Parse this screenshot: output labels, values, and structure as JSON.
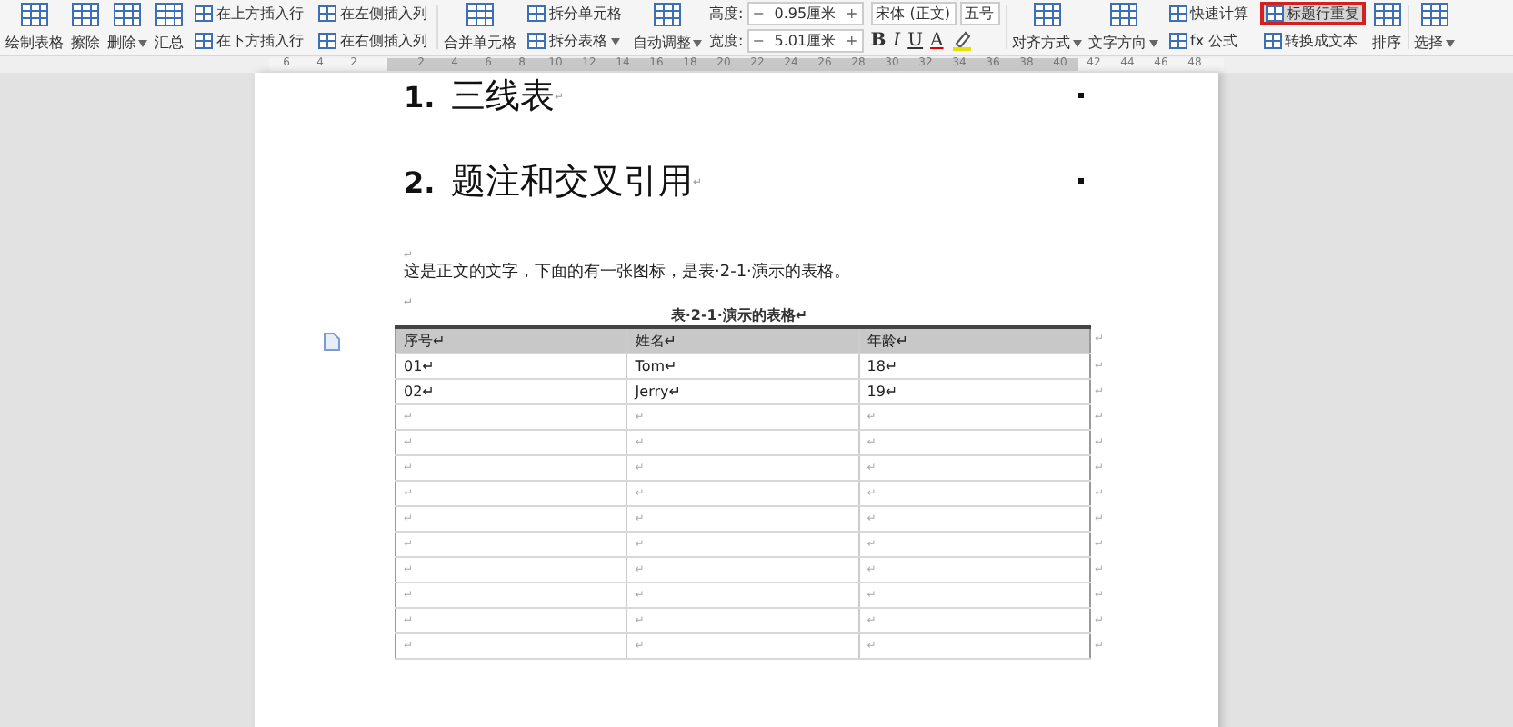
{
  "toolbar": {
    "items": [
      {
        "kind": "large",
        "label": "绘制表格",
        "dropdown": false
      },
      {
        "kind": "large",
        "label": "擦除",
        "dropdown": false
      },
      {
        "kind": "large",
        "label": "删除",
        "dropdown": true
      },
      {
        "kind": "large",
        "label": "汇总",
        "dropdown": false
      },
      {
        "kind": "stack",
        "rows": [
          {
            "label": "在上方插入行",
            "dropdown": false,
            "highlighted": false
          },
          {
            "label": "在下方插入行",
            "dropdown": false,
            "highlighted": false
          }
        ]
      },
      {
        "kind": "stack",
        "rows": [
          {
            "label": "在左侧插入列",
            "dropdown": false,
            "highlighted": false
          },
          {
            "label": "在右侧插入列",
            "dropdown": false,
            "highlighted": false
          }
        ]
      },
      {
        "kind": "large",
        "label": "合并单元格",
        "dropdown": false
      },
      {
        "kind": "stack",
        "rows": [
          {
            "label": "拆分单元格",
            "dropdown": false,
            "highlighted": false
          },
          {
            "label": "拆分表格",
            "dropdown": true,
            "highlighted": false
          }
        ]
      },
      {
        "kind": "large",
        "label": "自动调整",
        "dropdown": true
      },
      {
        "kind": "spin",
        "rows": [
          {
            "label": "高度:",
            "value": "0.95厘米",
            "minus": "−",
            "plus": "+"
          },
          {
            "label": "宽度:",
            "value": "5.01厘米",
            "minus": "−",
            "plus": "+"
          }
        ]
      },
      {
        "kind": "font",
        "font": "宋体 (正文)",
        "size": "五号",
        "buttons": [
          "B",
          "I",
          "U",
          "A"
        ]
      },
      {
        "kind": "large",
        "label": "对齐方式",
        "dropdown": true
      },
      {
        "kind": "large",
        "label": "文字方向",
        "dropdown": true
      },
      {
        "kind": "stack",
        "rows": [
          {
            "label": "快速计算",
            "dropdown": false,
            "highlighted": false
          },
          {
            "label": "fx 公式",
            "dropdown": false,
            "highlighted": false
          }
        ]
      },
      {
        "kind": "stack",
        "rows": [
          {
            "label": "标题行重复",
            "dropdown": false,
            "highlighted": true
          },
          {
            "label": "转换成文本",
            "dropdown": false,
            "highlighted": false
          }
        ]
      },
      {
        "kind": "large",
        "label": "排序",
        "dropdown": false
      },
      {
        "kind": "large",
        "label": "选择",
        "dropdown": true
      }
    ]
  },
  "ruler": {
    "labels": [
      "6",
      "4",
      "2",
      "2",
      "4",
      "6",
      "8",
      "10",
      "12",
      "14",
      "16",
      "18",
      "20",
      "22",
      "24",
      "26",
      "28",
      "30",
      "32",
      "34",
      "36",
      "38",
      "40",
      "42",
      "44",
      "46",
      "48"
    ]
  },
  "document": {
    "headings": [
      {
        "number": "1.",
        "text": "三线表",
        "mark": "↵"
      },
      {
        "number": "2.",
        "text": "题注和交叉引用",
        "mark": "↵"
      }
    ],
    "blank_mark_1": "↵",
    "body": "这是正文的文字，下面的有一张图标，是表·2-1·演示的表格。",
    "blank_mark_2": "↵",
    "caption": "表·2-1·演示的表格↵",
    "table": {
      "columns": [
        "序号↵",
        "姓名↵",
        "年龄↵"
      ],
      "header_end": "↵",
      "rows": [
        {
          "cells": [
            "01↵",
            "Tom↵",
            "18↵"
          ],
          "end": "↵"
        },
        {
          "cells": [
            "02↵",
            "Jerry↵",
            "19↵"
          ],
          "end": "↵"
        },
        {
          "cells": [
            "↵",
            "↵",
            "↵"
          ],
          "end": "↵"
        },
        {
          "cells": [
            "↵",
            "↵",
            "↵"
          ],
          "end": "↵"
        },
        {
          "cells": [
            "↵",
            "↵",
            "↵"
          ],
          "end": "↵"
        },
        {
          "cells": [
            "↵",
            "↵",
            "↵"
          ],
          "end": "↵"
        },
        {
          "cells": [
            "↵",
            "↵",
            "↵"
          ],
          "end": "↵"
        },
        {
          "cells": [
            "↵",
            "↵",
            "↵"
          ],
          "end": "↵"
        },
        {
          "cells": [
            "↵",
            "↵",
            "↵"
          ],
          "end": "↵"
        },
        {
          "cells": [
            "↵",
            "↵",
            "↵"
          ],
          "end": "↵"
        },
        {
          "cells": [
            "↵",
            "↵",
            "↵"
          ],
          "end": "↵"
        },
        {
          "cells": [
            "↵",
            "↵",
            "↵"
          ],
          "end": "↵"
        }
      ]
    }
  }
}
